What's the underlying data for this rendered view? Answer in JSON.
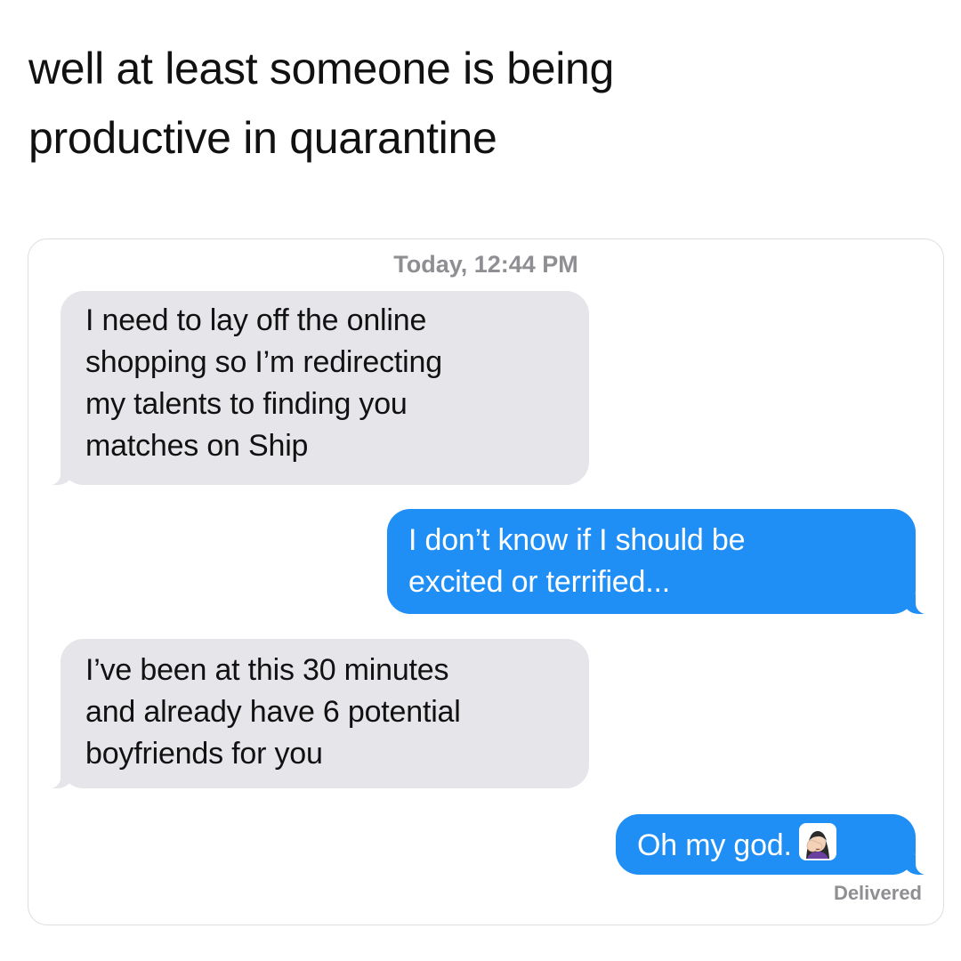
{
  "caption": {
    "lines": [
      "well at least someone is being",
      "productive in quarantine"
    ]
  },
  "conversation": {
    "timestamp": "Today, 12:44 PM",
    "messages": [
      {
        "direction": "incoming",
        "lines": [
          "I need to lay off the online",
          "shopping so I’m redirecting",
          "my talents to finding you",
          "matches on Ship"
        ]
      },
      {
        "direction": "outgoing",
        "lines": [
          "I don’t know if I should be",
          "excited or terrified..."
        ]
      },
      {
        "direction": "incoming",
        "lines": [
          "I’ve been at this 30 minutes",
          "and already have 6 potential",
          "boyfriends for you"
        ]
      },
      {
        "direction": "outgoing",
        "text": "Oh my god.",
        "emoji": "woman-facepalming-emoji"
      }
    ],
    "status": "Delivered"
  },
  "colors": {
    "incoming_bubble": "#e5e5ea",
    "outgoing_bubble": "#1f8ff6",
    "meta_text": "#8e8e93"
  }
}
